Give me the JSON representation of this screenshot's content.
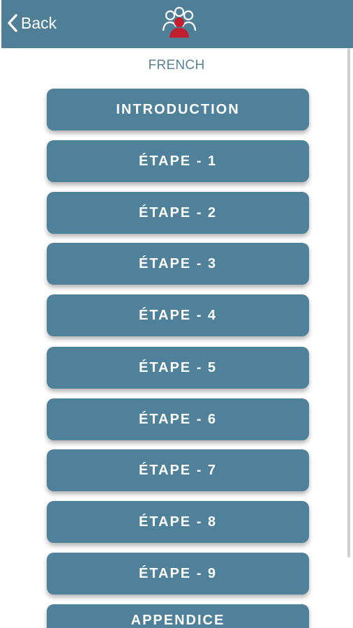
{
  "header": {
    "back_label": "Back",
    "back_icon": "chevron-left-icon",
    "logo_icon": "group-people-icon",
    "background": "#4e7f97"
  },
  "page": {
    "title": "FRENCH"
  },
  "menu": {
    "items": [
      {
        "label": "INTRODUCTION"
      },
      {
        "label": "ÉTAPE - 1"
      },
      {
        "label": "ÉTAPE - 2"
      },
      {
        "label": "ÉTAPE - 3"
      },
      {
        "label": "ÉTAPE - 4"
      },
      {
        "label": "ÉTAPE - 5"
      },
      {
        "label": "ÉTAPE - 6"
      },
      {
        "label": "ÉTAPE - 7"
      },
      {
        "label": "ÉTAPE - 8"
      },
      {
        "label": "ÉTAPE - 9"
      },
      {
        "label": "APPENDICE"
      }
    ],
    "button_color": "#50819a"
  },
  "colors": {
    "title_text": "#5a8196",
    "logo_accent": "#c21f2e"
  }
}
